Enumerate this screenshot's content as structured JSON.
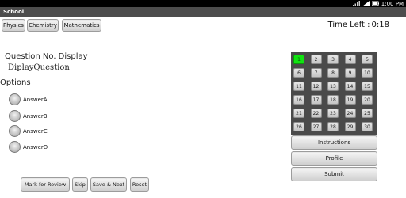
{
  "status_bar": {
    "time": "1:00",
    "time_suffix": "PM"
  },
  "window": {
    "title": "School"
  },
  "subjects": [
    "Physics",
    "Chemistry",
    "Mathematics"
  ],
  "timer": {
    "label": "Time Left :",
    "value": "0:18"
  },
  "question": {
    "display": "Question No. Display",
    "text": "DiplayQuestion"
  },
  "options": {
    "heading": "Options",
    "answers": [
      "AnswerA",
      "AnswerB",
      "AnswerC",
      "AnswerD"
    ]
  },
  "question_grid": {
    "active": "1",
    "numbers": [
      "1",
      "2",
      "3",
      "4",
      "5",
      "6",
      "7",
      "8",
      "9",
      "10",
      "11",
      "12",
      "13",
      "14",
      "15",
      "16",
      "17",
      "18",
      "19",
      "20",
      "21",
      "22",
      "23",
      "24",
      "25",
      "26",
      "27",
      "28",
      "29",
      "30"
    ]
  },
  "side_buttons": {
    "instructions": "Instructions",
    "profile": "Profile",
    "submit": "Submit"
  },
  "bottom_buttons": {
    "mark_review": "Mark for Review",
    "skip": "Skip",
    "save_next": "Save & Next",
    "reset": "Reset"
  },
  "colors": {
    "active_cell": "#12e312",
    "grid_panel": "#4a4a4a",
    "title_bar": "#4d4d4d",
    "status_bar": "#000000"
  }
}
